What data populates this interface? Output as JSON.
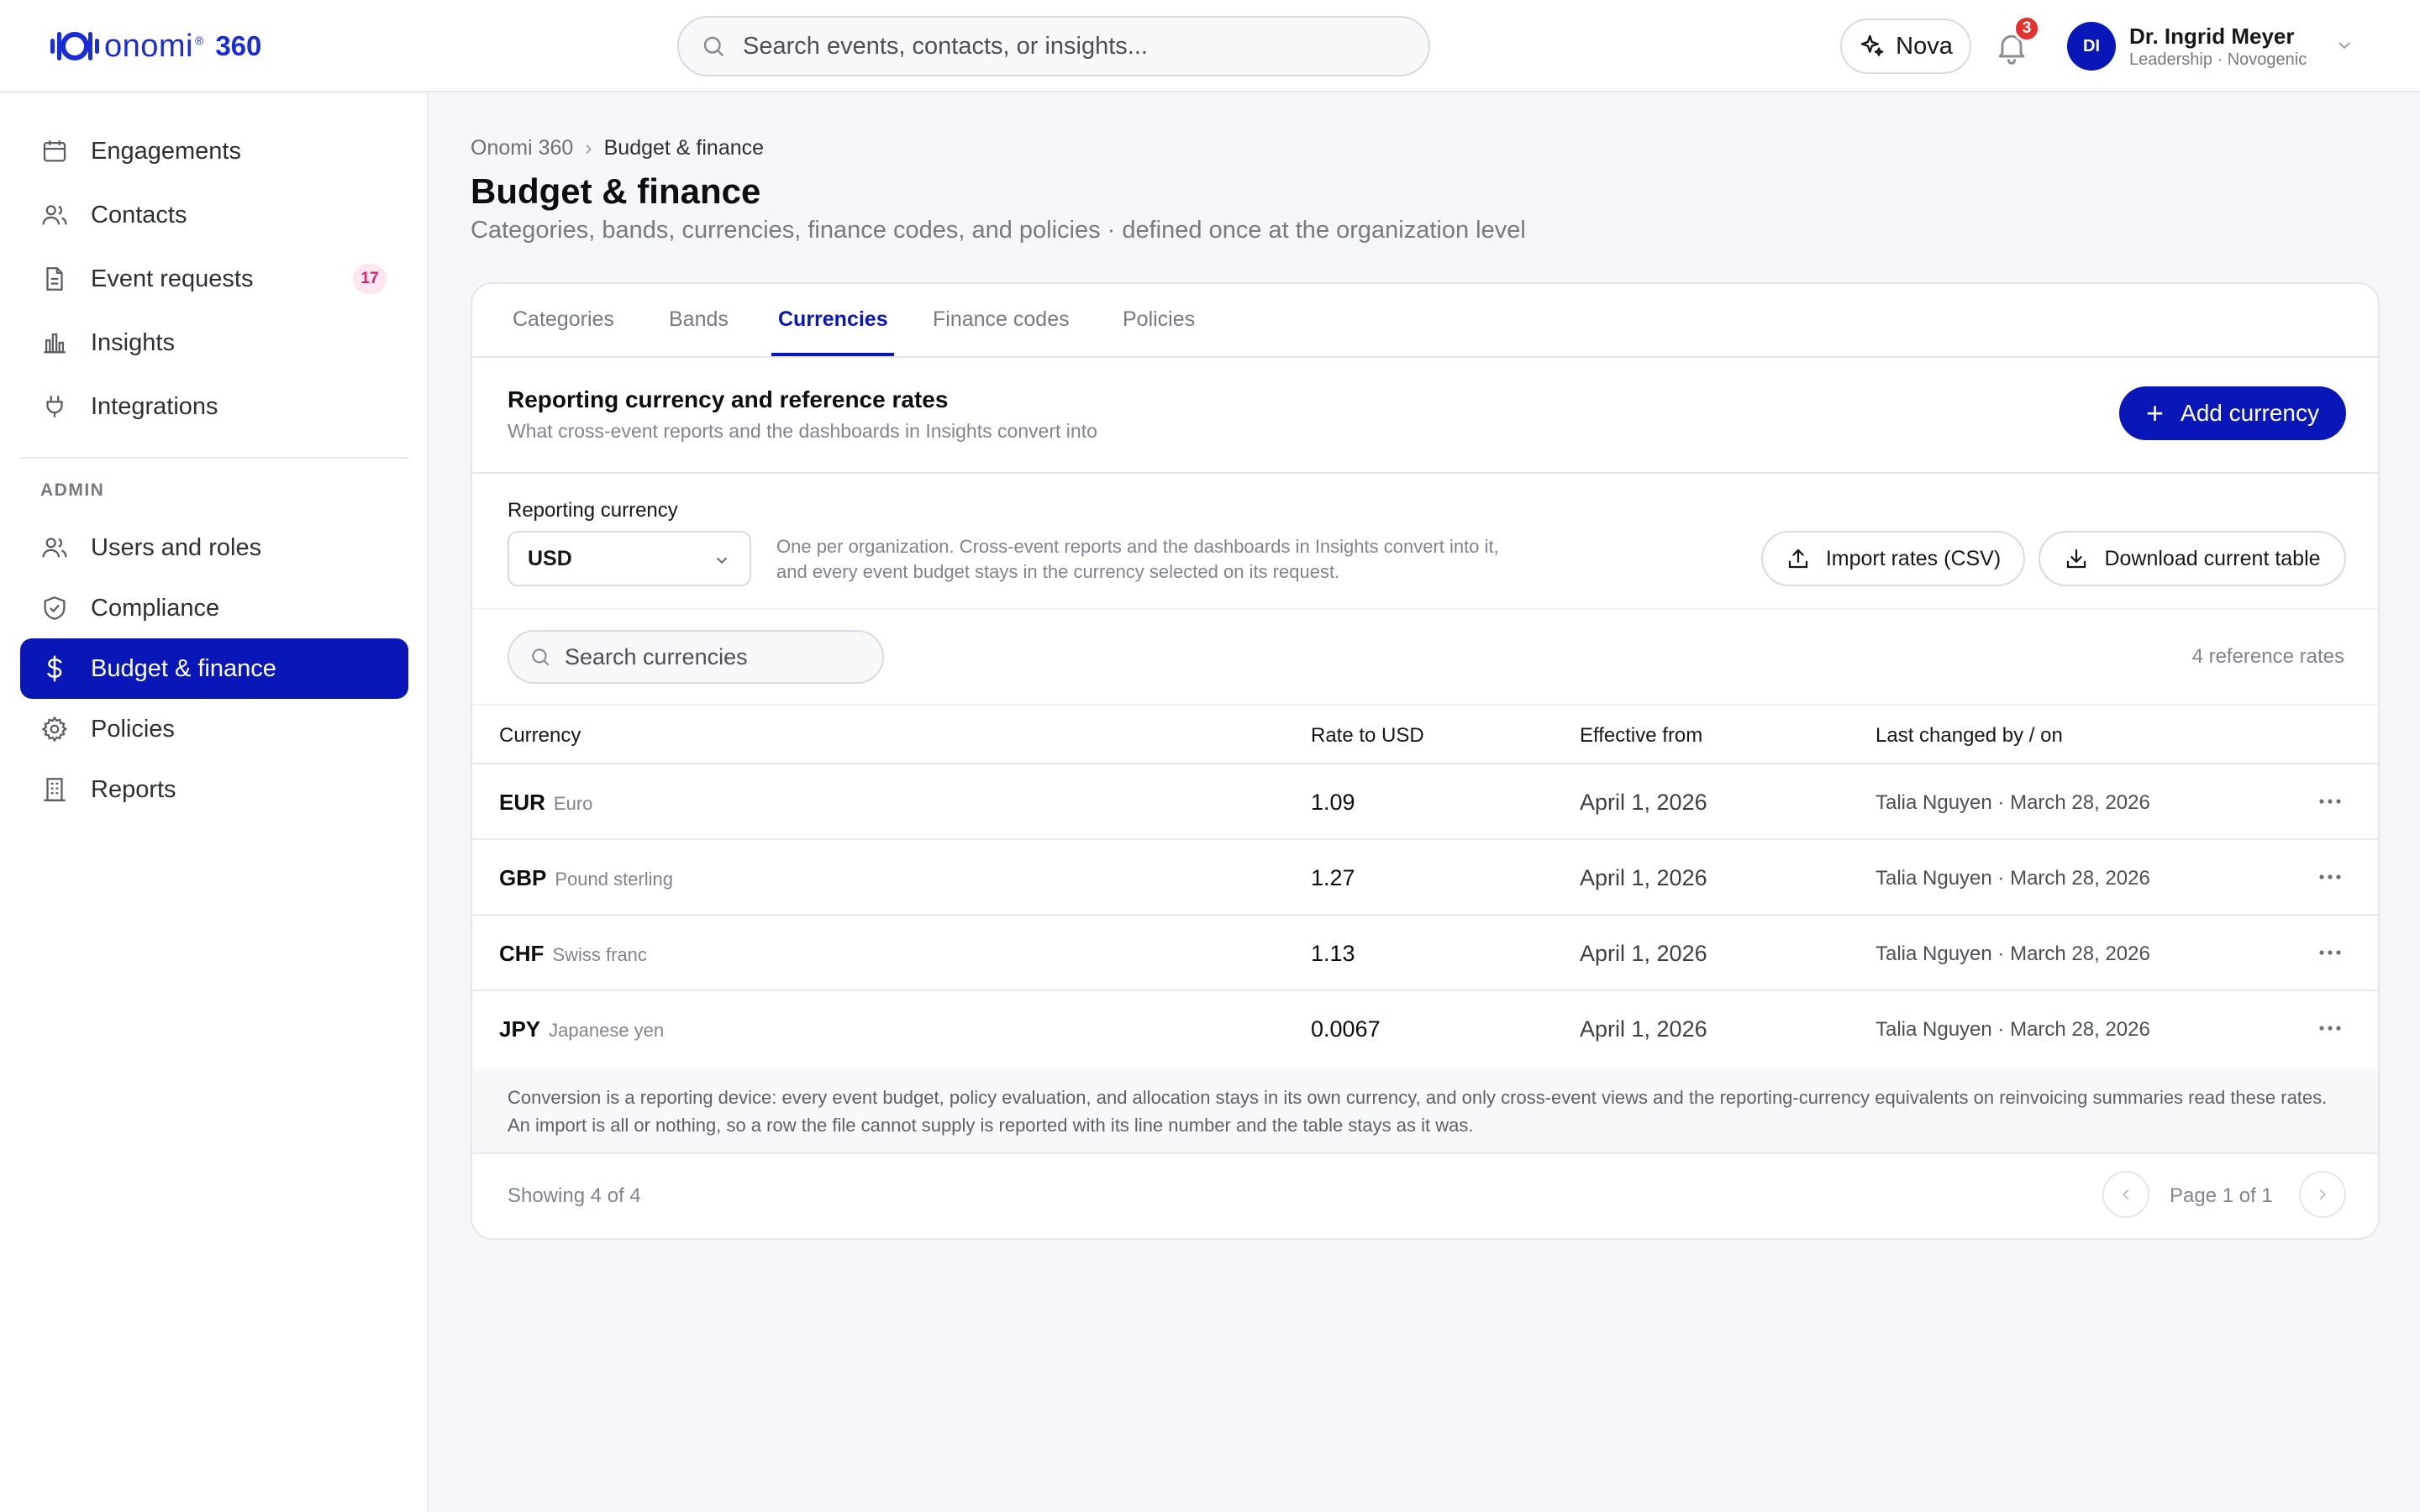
{
  "app": {
    "brand": "onomi",
    "brand_suffix": "360"
  },
  "search": {
    "placeholder": "Search events, contacts, or insights..."
  },
  "header": {
    "nova_label": "Nova",
    "notifications_count": "3",
    "user": {
      "initials": "DI",
      "name": "Dr. Ingrid Meyer",
      "subtitle": "Leadership · Novogenic"
    }
  },
  "sidebar": {
    "items": [
      {
        "label": "Engagements",
        "icon": "calendar-icon"
      },
      {
        "label": "Contacts",
        "icon": "users-icon"
      },
      {
        "label": "Event requests",
        "icon": "document-icon",
        "badge": "17"
      },
      {
        "label": "Insights",
        "icon": "bar-chart-icon"
      },
      {
        "label": "Integrations",
        "icon": "plug-icon"
      }
    ],
    "admin_heading": "ADMIN",
    "admin_items": [
      {
        "label": "Users and roles",
        "icon": "users-icon"
      },
      {
        "label": "Compliance",
        "icon": "shield-check-icon"
      },
      {
        "label": "Budget & finance",
        "icon": "dollar-icon",
        "active": true
      },
      {
        "label": "Policies",
        "icon": "gear-icon"
      },
      {
        "label": "Reports",
        "icon": "building-icon"
      }
    ]
  },
  "breadcrumb": {
    "root": "Onomi 360",
    "current": "Budget & finance"
  },
  "page": {
    "title": "Budget & finance",
    "subtitle": "Categories, bands, currencies, finance codes, and policies · defined once at the organization level"
  },
  "tabs": [
    {
      "label": "Categories"
    },
    {
      "label": "Bands"
    },
    {
      "label": "Currencies",
      "active": true
    },
    {
      "label": "Finance codes"
    },
    {
      "label": "Policies"
    }
  ],
  "section": {
    "title": "Reporting currency and reference rates",
    "subtitle": "What cross-event reports and the dashboards in Insights convert into",
    "add_button": "Add currency"
  },
  "reporting": {
    "label": "Reporting currency",
    "selected": "USD",
    "note": "One per organization. Cross-event reports and the dashboards in Insights convert into it, and every event budget stays in the currency selected on its request.",
    "import_button": "Import rates (CSV)",
    "download_button": "Download current table"
  },
  "currency_search": {
    "placeholder": "Search currencies"
  },
  "ref_count": "4 reference rates",
  "table": {
    "headers": {
      "currency": "Currency",
      "rate": "Rate to USD",
      "effective": "Effective from",
      "changed": "Last changed by / on"
    },
    "rows": [
      {
        "code": "EUR",
        "name": "Euro",
        "rate": "1.09",
        "effective": "April 1, 2026",
        "changed": "Talia Nguyen · March 28, 2026"
      },
      {
        "code": "GBP",
        "name": "Pound sterling",
        "rate": "1.27",
        "effective": "April 1, 2026",
        "changed": "Talia Nguyen · March 28, 2026"
      },
      {
        "code": "CHF",
        "name": "Swiss franc",
        "rate": "1.13",
        "effective": "April 1, 2026",
        "changed": "Talia Nguyen · March 28, 2026"
      },
      {
        "code": "JPY",
        "name": "Japanese yen",
        "rate": "0.0067",
        "effective": "April 1, 2026",
        "changed": "Talia Nguyen · March 28, 2026"
      }
    ],
    "footnote": "Conversion is a reporting device: every event budget, policy evaluation, and allocation stays in its own currency, and only cross-event views and the reporting-currency equivalents on reinvoicing summaries read these rates. An import is all or nothing, so a row the file cannot supply is reported with its line number and the table stays as it was."
  },
  "pagination": {
    "showing": "Showing 4 of 4",
    "page": "Page 1 of 1"
  },
  "colors": {
    "accent": "#0a17b8",
    "brand": "#1a2cd6",
    "badge": "#e5322f"
  }
}
